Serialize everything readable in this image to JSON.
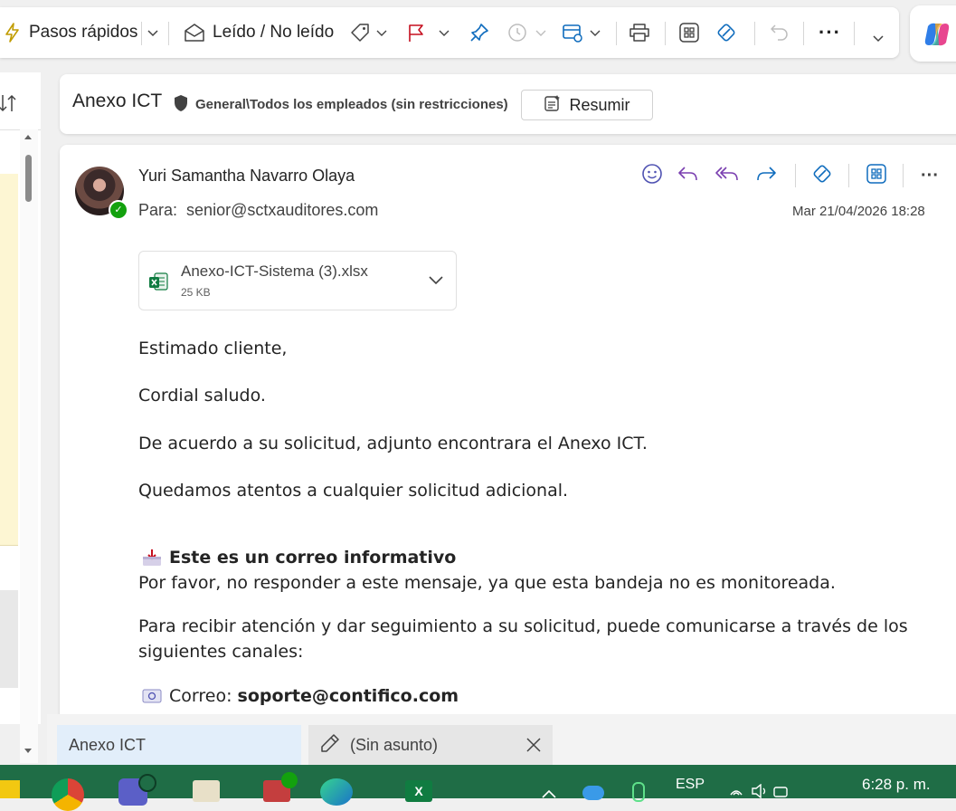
{
  "toolbar": {
    "quick_steps": "Pasos rápidos",
    "read_unread": "Leído / No leído",
    "icons": [
      "lightning-icon",
      "chevron-down-icon",
      "envelope-open-icon",
      "tag-icon",
      "flag-icon",
      "pin-icon",
      "clock-icon",
      "rules-icon",
      "print-icon",
      "apps-icon",
      "translate-icon",
      "undo-icon",
      "more-icon",
      "expand-icon",
      "copilot-icon"
    ]
  },
  "subject": {
    "title": "Anexo ICT",
    "sensitivity": "General\\Todos los empleados (sin restricciones)",
    "summarize": "Resumir"
  },
  "message": {
    "sender": "Yuri Samantha Navarro Olaya",
    "to_label": "Para:",
    "to": "senior@sctxauditores.com",
    "date": "Mar 21/04/2026 18:28",
    "attachment": {
      "name": "Anexo-ICT-Sistema (3).xlsx",
      "size": "25 KB"
    },
    "body": {
      "greeting": "Estimado cliente,",
      "salute": "Cordial saludo.",
      "line1": "De acuerdo a su solicitud, adjunto encontrara el Anexo ICT.",
      "line2": "Quedamos atentos a cualquier solicitud adicional.",
      "notice_title": "Este es un correo informativo",
      "notice_text": "Por favor, no responder a este mensaje, ya que esta bandeja no es monitoreada.",
      "channels_line1": "Para recibir atención y dar seguimiento a su solicitud, puede comunicarse a través de los",
      "channels_line2": "siguientes canales:",
      "email_label": "Correo:",
      "email_value": "soporte@contifico.com"
    }
  },
  "tabs": [
    {
      "label": "Anexo ICT"
    },
    {
      "label": "(Sin asunto)"
    }
  ],
  "taskbar": {
    "language": "ESP",
    "time": "6:28 p. m."
  },
  "colors": {
    "accent": "#0f6cbd",
    "reply_purple": "#7a3fb0",
    "taskbar": "#1f6d46",
    "excel_green": "#107c41"
  }
}
